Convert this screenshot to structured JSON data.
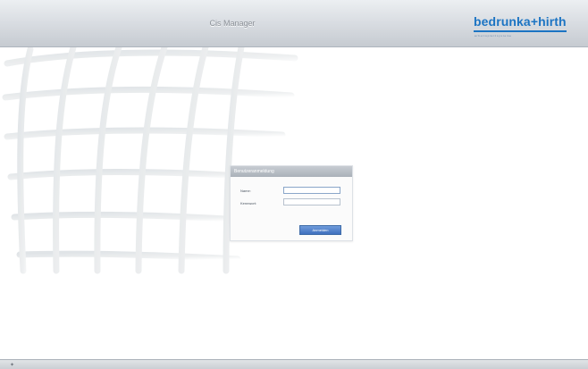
{
  "header": {
    "title": "Cis Manager"
  },
  "brand": {
    "name": "bedrunka+hirth",
    "tagline": "arbeitsplatzsysteme"
  },
  "login": {
    "title": "Benutzeranmeldung",
    "username_label": "Name:",
    "password_label": "Kennwort:",
    "username_value": "",
    "password_value": "",
    "button_label": "Anmelden"
  },
  "footer": {
    "icon": "logo-icon",
    "text": ""
  },
  "colors": {
    "accent": "#1c74c3",
    "button": "#4f84d0",
    "header": "#d9dde2"
  }
}
